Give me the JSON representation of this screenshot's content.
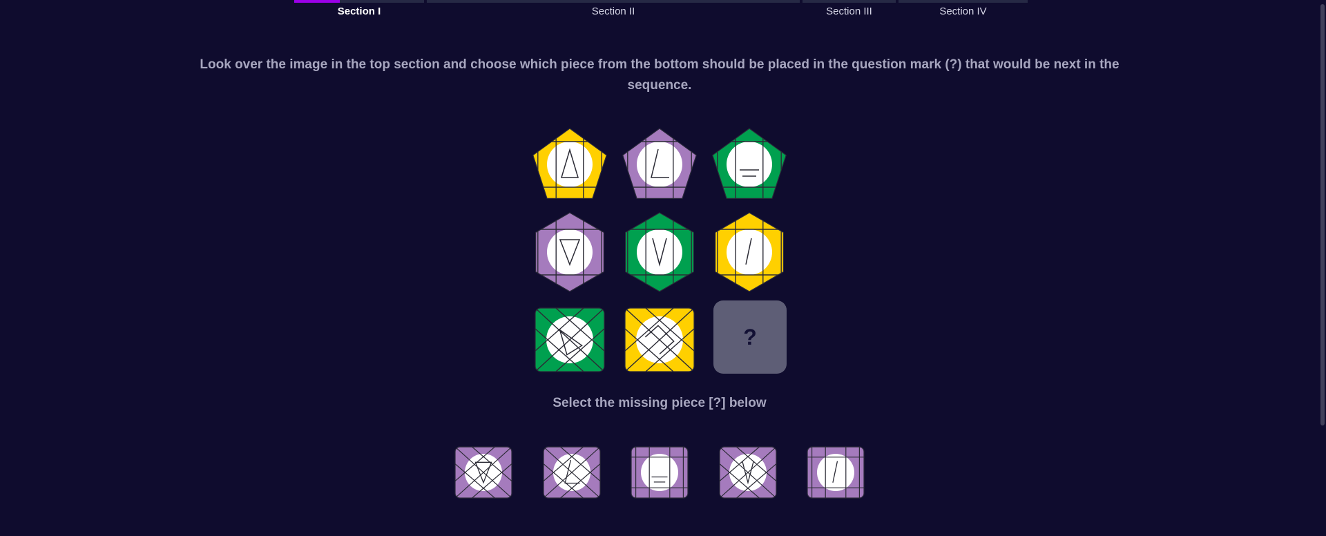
{
  "sections": [
    {
      "label": "Section I",
      "active": true,
      "progress": 0.35
    },
    {
      "label": "Section II",
      "active": false,
      "progress": 0
    },
    {
      "label": "Section III",
      "active": false,
      "progress": 0
    },
    {
      "label": "Section IV",
      "active": false,
      "progress": 0
    }
  ],
  "instruction": "Look over the image in the top section and choose which piece from the bottom should be placed in the question mark (?) that would be next in the sequence.",
  "question_mark": "?",
  "select_prompt": "Select the missing piece [?] below",
  "colors": {
    "yellow": "#ffd000",
    "purple": "#a57bbd",
    "green": "#00a04f",
    "background": "#0f0c2e",
    "accent": "#9b00e8",
    "question_tile": "#5e5e76"
  },
  "matrix": [
    {
      "shape": "pentagon",
      "color": "yellow",
      "symbol": "triangle-up"
    },
    {
      "shape": "pentagon",
      "color": "purple",
      "symbol": "angle-l"
    },
    {
      "shape": "pentagon",
      "color": "green",
      "symbol": "bars"
    },
    {
      "shape": "hexagon",
      "color": "purple",
      "symbol": "triangle-down"
    },
    {
      "shape": "hexagon",
      "color": "green",
      "symbol": "v"
    },
    {
      "shape": "hexagon",
      "color": "yellow",
      "symbol": "slash"
    },
    {
      "shape": "square",
      "color": "green",
      "symbol": "triangle-right"
    },
    {
      "shape": "square",
      "color": "yellow",
      "symbol": "chevron-right"
    },
    {
      "shape": "missing",
      "color": "",
      "symbol": ""
    }
  ],
  "options": [
    {
      "color": "purple",
      "grid": "diagonal",
      "symbol": "triangle-down"
    },
    {
      "color": "purple",
      "grid": "diagonal",
      "symbol": "angle-l"
    },
    {
      "color": "purple",
      "grid": "straight",
      "symbol": "bars"
    },
    {
      "color": "purple",
      "grid": "diagonal",
      "symbol": "v"
    },
    {
      "color": "purple",
      "grid": "straight",
      "symbol": "slash"
    }
  ]
}
